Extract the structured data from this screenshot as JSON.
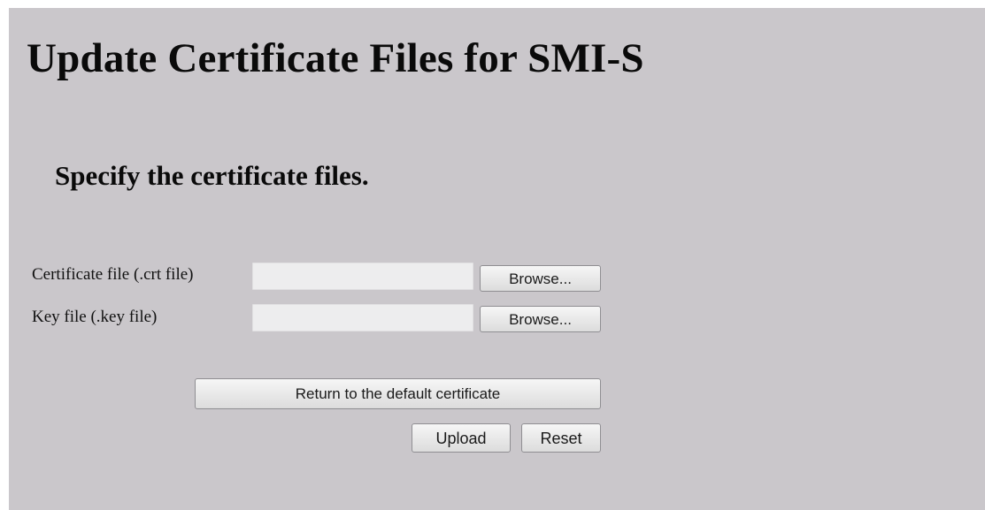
{
  "page": {
    "title": "Update Certificate Files for SMI-S",
    "subtitle": "Specify the certificate files."
  },
  "form": {
    "certificate_label": "Certificate file (.crt file)",
    "certificate_value": "",
    "key_label": "Key file (.key file)",
    "key_value": "",
    "browse_label": "Browse...",
    "default_button": "Return to the default certificate",
    "upload_button": "Upload",
    "reset_button": "Reset"
  },
  "colors": {
    "background": "#cac7cb",
    "input_background": "#ededee",
    "button_border": "#8f8e92"
  }
}
